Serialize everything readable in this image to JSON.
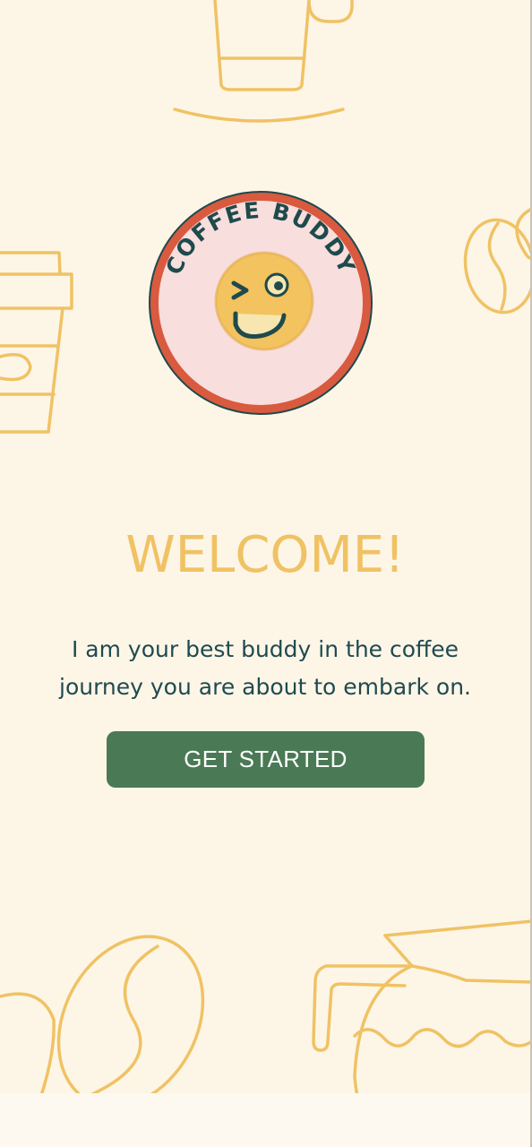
{
  "logo": {
    "ring_text_top": "COFFEE BUDDY",
    "ring_text_bottom": "COFFEE BUDDY"
  },
  "welcome": {
    "title": "WELCOME!",
    "tagline_line1": "I am your best buddy in the coffee",
    "tagline_line2": "journey you are about to embark on."
  },
  "cta": {
    "label": "GET STARTED"
  },
  "colors": {
    "background": "#fdf6e7",
    "accent_yellow": "#f0c264",
    "button_green": "#4a7a55",
    "text_teal": "#1f4a50",
    "logo_red": "#d95a3f",
    "logo_pink": "#f8dedd"
  }
}
